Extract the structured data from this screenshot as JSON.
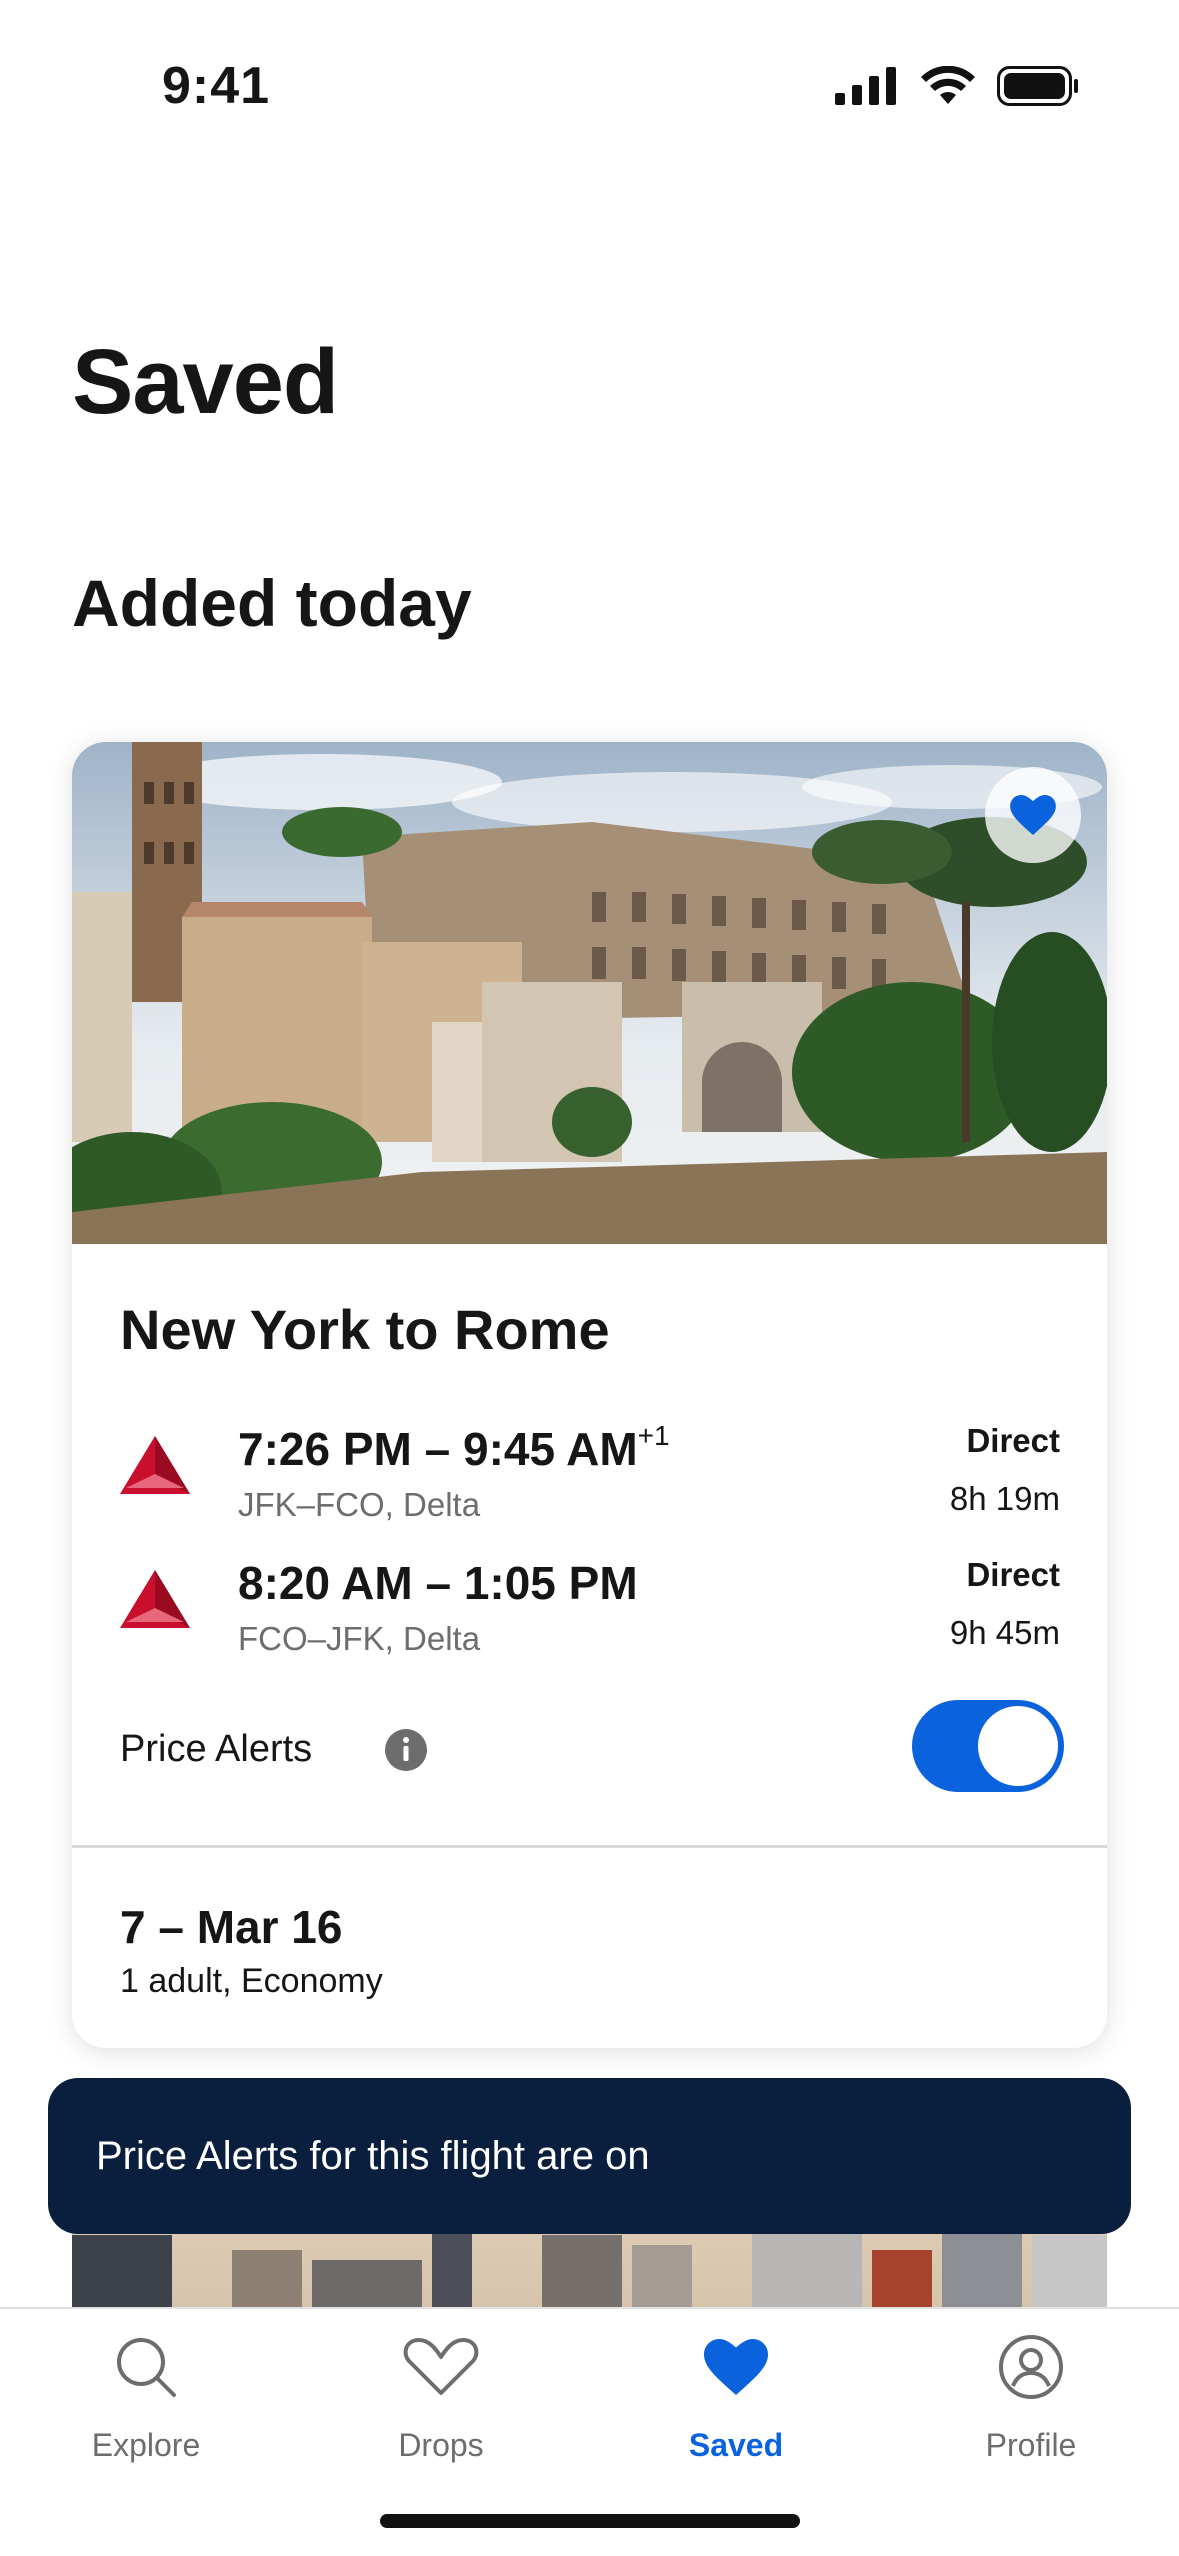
{
  "status_bar": {
    "time": "9:41"
  },
  "page": {
    "title": "Saved",
    "section_title": "Added today"
  },
  "card": {
    "title": "New York to Rome",
    "legs": [
      {
        "times": "7:26 PM – 9:45 AM",
        "day_offset": "+1",
        "route": "JFK–FCO, Delta",
        "stops": "Direct",
        "duration": "8h 19m"
      },
      {
        "times": "8:20 AM – 1:05 PM",
        "day_offset": "",
        "route": "FCO–JFK, Delta",
        "stops": "Direct",
        "duration": "9h 45m"
      }
    ],
    "price_alerts_label": "Price Alerts",
    "price_alerts_on": true,
    "dates": "7 – Mar 16",
    "travellers": "1 adult, Economy"
  },
  "toast": {
    "message": "Price Alerts for this flight are on"
  },
  "tabs": [
    {
      "label": "Explore",
      "icon": "search-icon",
      "active": false
    },
    {
      "label": "Drops",
      "icon": "heart-chevron-icon",
      "active": false
    },
    {
      "label": "Saved",
      "icon": "heart-icon",
      "active": true
    },
    {
      "label": "Profile",
      "icon": "profile-icon",
      "active": false
    }
  ],
  "colors": {
    "accent": "#0a63dc",
    "toast_bg": "#0a1f3d",
    "delta_red": "#c8102e"
  }
}
